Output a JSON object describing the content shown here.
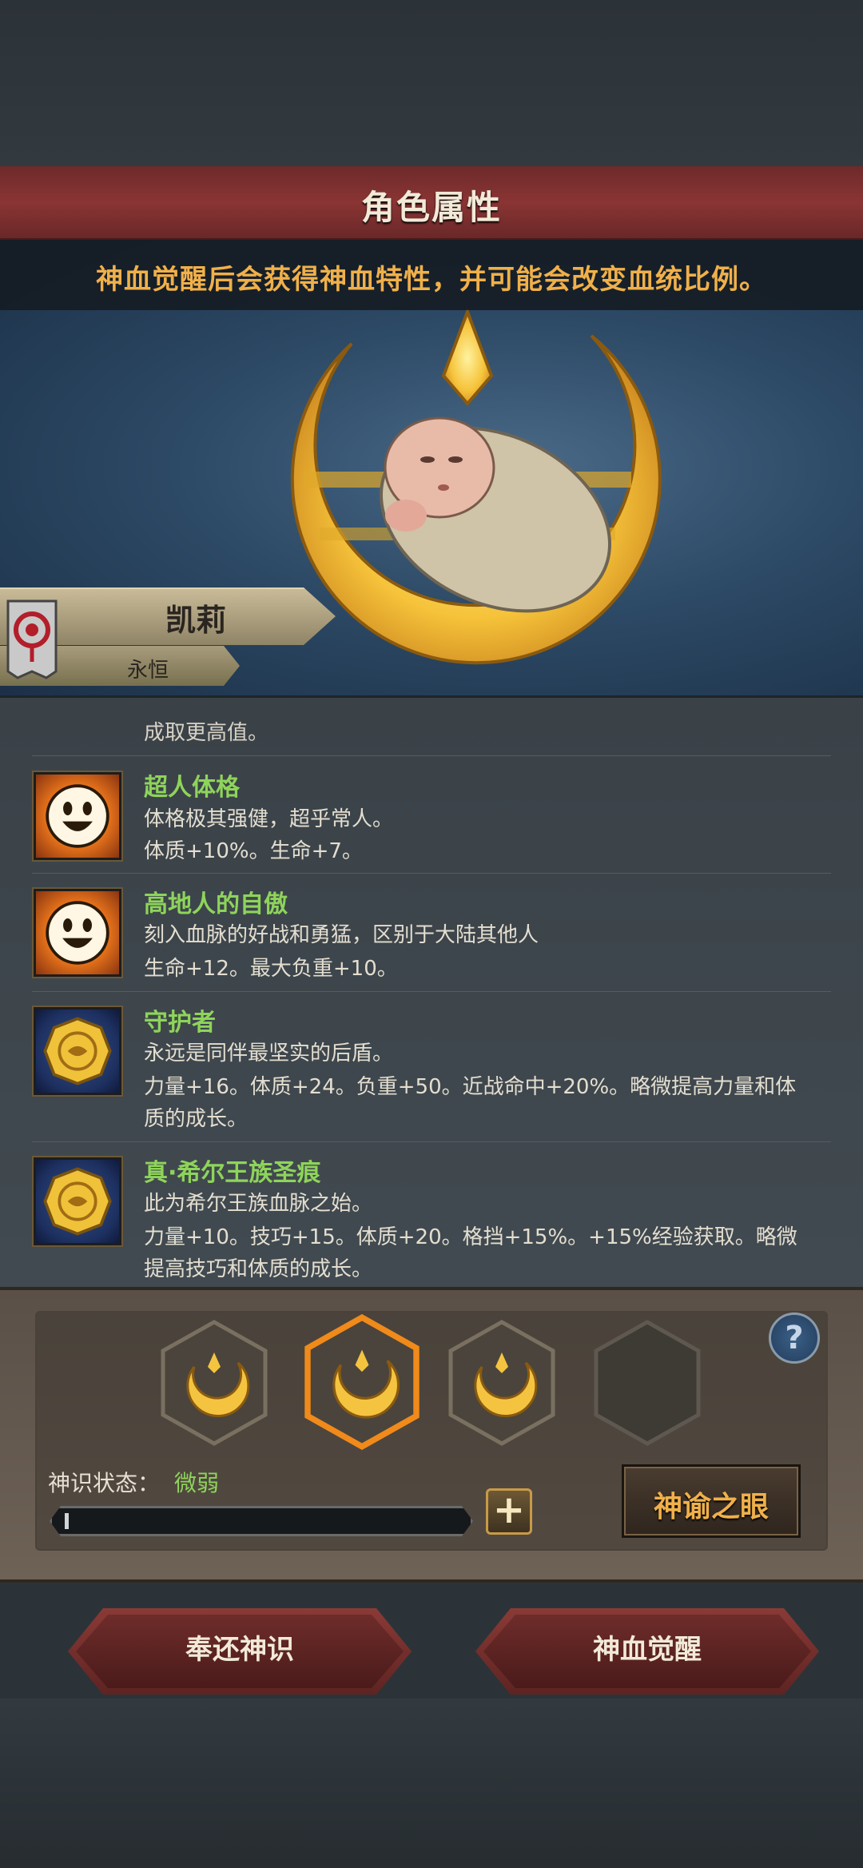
{
  "header": {
    "title": "角色属性"
  },
  "notice": "神血觉醒后会获得神血特性，并可能会改变血统比例。",
  "character": {
    "name": "凯莉",
    "subtitle": "永恒"
  },
  "traits_partial_line": "成取更高值。",
  "traits": [
    {
      "name": "超人体格",
      "icon": "smile-face-icon",
      "desc": [
        "体格极其强健，超乎常人。",
        "体质+10%。生命+7。"
      ]
    },
    {
      "name": "高地人的自傲",
      "icon": "smile-face-icon",
      "desc": [
        "刻入血脉的好战和勇猛，区别于大陆其他人",
        "生命+12。最大负重+10。"
      ]
    },
    {
      "name": "守护者",
      "icon": "gold-coin-icon",
      "desc": [
        "永远是同伴最坚实的后盾。",
        "力量+16。体质+24。负重+50。近战命中+20%。略微提高力量和体",
        "质的成长。"
      ]
    },
    {
      "name": "真·希尔王族圣痕",
      "icon": "gold-coin-icon",
      "desc": [
        "此为希尔王族血脉之始。",
        "力量+10。技巧+15。体质+20。格挡+15%。+15%经验获取。略微",
        "提高技巧和体质的成长。"
      ]
    }
  ],
  "panel": {
    "state_label": "神识状态：",
    "state_value": "微弱",
    "progress": 0.01,
    "plus_label": "+",
    "oracle_label": "神谕之眼",
    "help_label": "?"
  },
  "buttons": {
    "return_label": "奉还神识",
    "awaken_label": "神血觉醒"
  },
  "colors": {
    "accent_gold": "#f0b04a",
    "trait_green": "#8ed45a",
    "banner_red": "#8a3434"
  }
}
